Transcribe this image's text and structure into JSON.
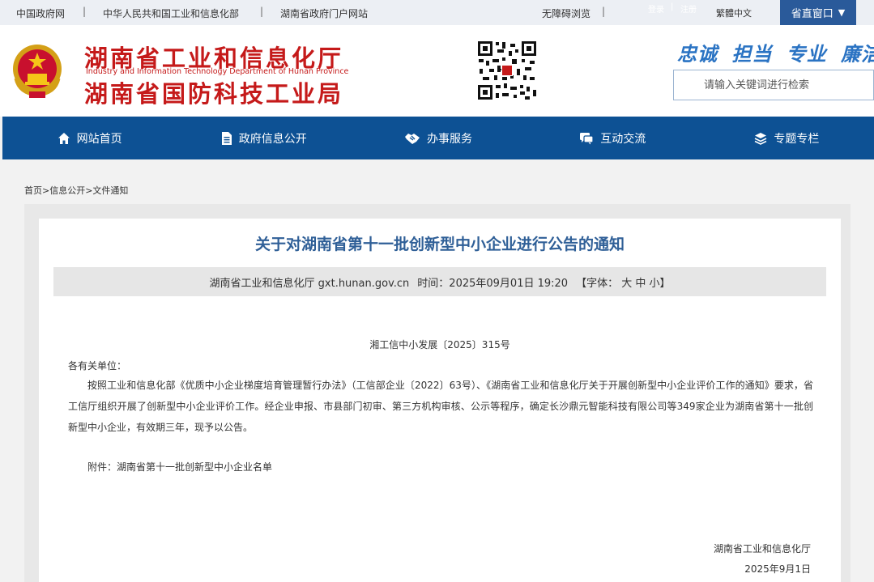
{
  "topbar": {
    "links": [
      "中国政府网",
      "中华人民共和国工业和信息化部",
      "湖南省政府门户网站"
    ],
    "accessibility": "无障碍浏览",
    "login": "登录",
    "register": "注册",
    "divider": "|",
    "traditional": "繁體中文",
    "province_window": "省直窗口"
  },
  "header": {
    "title_cn_1": "湖南省工业和信息化厅",
    "title_en": "Industry and Information Technology Department of Hunan Province",
    "title_cn_2": "湖南省国防科技工业局",
    "slogan": "忠诚 担当 专业 廉洁",
    "search_placeholder": "请输入关键词进行检索"
  },
  "nav": {
    "items": [
      {
        "label": "网站首页",
        "icon": "home-icon"
      },
      {
        "label": "政府信息公开",
        "icon": "document-icon"
      },
      {
        "label": "办事服务",
        "icon": "handshake-icon"
      },
      {
        "label": "互动交流",
        "icon": "chat-icon"
      },
      {
        "label": "专题专栏",
        "icon": "layers-icon"
      }
    ]
  },
  "breadcrumb": "首页>信息公开>文件通知",
  "article": {
    "title": "关于对湖南省第十一批创新型中小企业进行公告的通知",
    "source": "湖南省工业和信息化厅 gxt.hunan.gov.cn",
    "time": "时间：2025年09月01日 19:20",
    "font_size": "【字体： 大 中 小】",
    "doc_number": "湘工信中小发展〔2025〕315号",
    "greeting": "各有关单位：",
    "body": "按照工业和信息化部《优质中小企业梯度培育管理暂行办法》（工信部企业〔2022〕63号）、《湖南省工业和信息化厅关于开展创新型中小企业评价工作的通知》要求，省工信厅组织开展了创新型中小企业评价工作。经企业申报、市县部门初审、第三方机构审核、公示等程序，确定长沙鼎元智能科技有限公司等349家企业为湖南省第十一批创新型中小企业，有效期三年，现予以公告。",
    "attachment": "附件：湖南省第十一批创新型中小企业名单",
    "signature_org": "湖南省工业和信息化厅",
    "signature_date": "2025年9月1日"
  },
  "colors": {
    "brand_red": "#c51a1a",
    "nav_blue": "#0d5194",
    "title_blue": "#2f5f97",
    "slogan_blue": "#2a73c3"
  }
}
